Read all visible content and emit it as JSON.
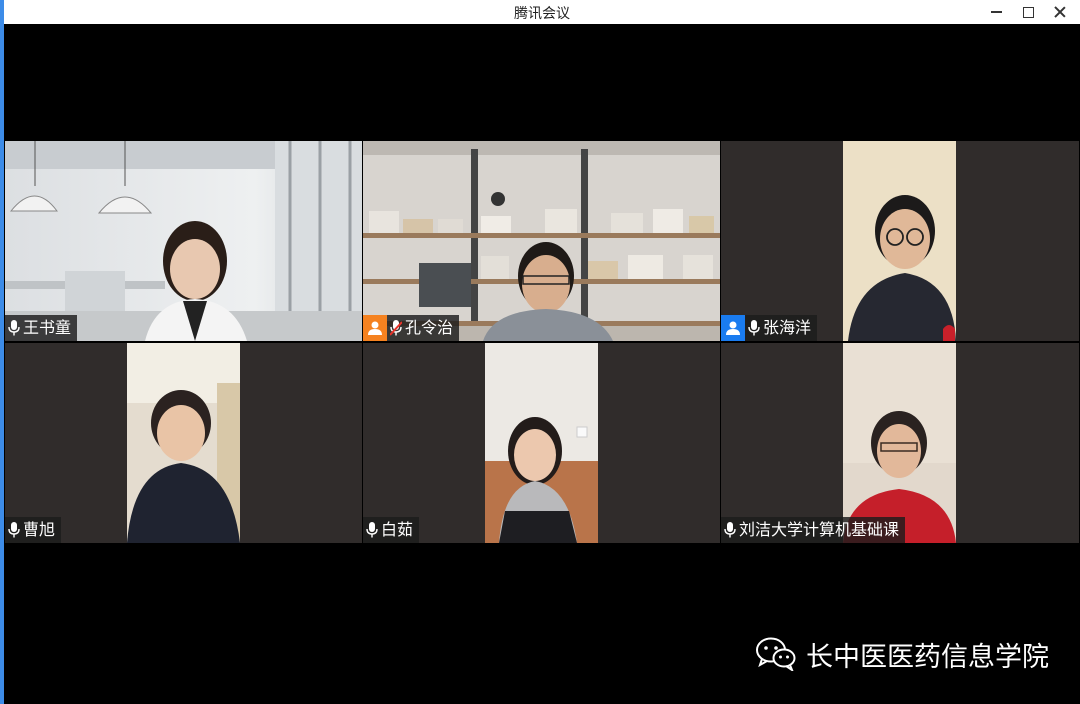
{
  "window": {
    "title": "腾讯会议",
    "controls": {
      "minimize": "minimize",
      "maximize": "maximize",
      "close": "close"
    }
  },
  "colors": {
    "accent_border": "#3d8ce8",
    "active_speaker": "#35c48a",
    "tile_bg": "#302c2b",
    "host_badge": "#f58220",
    "cohost_badge": "#1a7cf0"
  },
  "participants": [
    {
      "name": "王书童",
      "mic": "on",
      "badge": null,
      "active": true
    },
    {
      "name": "孔令治",
      "mic": "muted",
      "badge": "host",
      "active": false
    },
    {
      "name": "张海洋",
      "mic": "on",
      "badge": "cohost",
      "active": false
    },
    {
      "name": "曹旭",
      "mic": "on",
      "badge": null,
      "active": false
    },
    {
      "name": "白茹",
      "mic": "on",
      "badge": null,
      "active": false
    },
    {
      "name": "刘洁大学计算机基础课",
      "mic": "on",
      "badge": null,
      "active": false
    }
  ],
  "watermark": {
    "icon": "wechat-icon",
    "text": "长中医医药信息学院"
  }
}
